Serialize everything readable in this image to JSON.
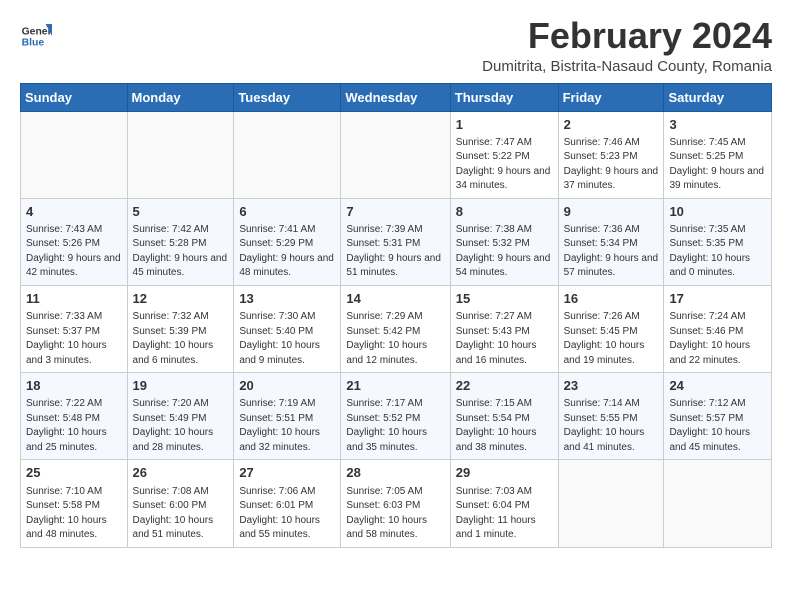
{
  "header": {
    "logo_general": "General",
    "logo_blue": "Blue",
    "month_title": "February 2024",
    "subtitle": "Dumitrita, Bistrita-Nasaud County, Romania"
  },
  "calendar": {
    "days_of_week": [
      "Sunday",
      "Monday",
      "Tuesday",
      "Wednesday",
      "Thursday",
      "Friday",
      "Saturday"
    ],
    "rows": [
      [
        {
          "day": "",
          "info": ""
        },
        {
          "day": "",
          "info": ""
        },
        {
          "day": "",
          "info": ""
        },
        {
          "day": "",
          "info": ""
        },
        {
          "day": "1",
          "info": "Sunrise: 7:47 AM\nSunset: 5:22 PM\nDaylight: 9 hours and 34 minutes."
        },
        {
          "day": "2",
          "info": "Sunrise: 7:46 AM\nSunset: 5:23 PM\nDaylight: 9 hours and 37 minutes."
        },
        {
          "day": "3",
          "info": "Sunrise: 7:45 AM\nSunset: 5:25 PM\nDaylight: 9 hours and 39 minutes."
        }
      ],
      [
        {
          "day": "4",
          "info": "Sunrise: 7:43 AM\nSunset: 5:26 PM\nDaylight: 9 hours and 42 minutes."
        },
        {
          "day": "5",
          "info": "Sunrise: 7:42 AM\nSunset: 5:28 PM\nDaylight: 9 hours and 45 minutes."
        },
        {
          "day": "6",
          "info": "Sunrise: 7:41 AM\nSunset: 5:29 PM\nDaylight: 9 hours and 48 minutes."
        },
        {
          "day": "7",
          "info": "Sunrise: 7:39 AM\nSunset: 5:31 PM\nDaylight: 9 hours and 51 minutes."
        },
        {
          "day": "8",
          "info": "Sunrise: 7:38 AM\nSunset: 5:32 PM\nDaylight: 9 hours and 54 minutes."
        },
        {
          "day": "9",
          "info": "Sunrise: 7:36 AM\nSunset: 5:34 PM\nDaylight: 9 hours and 57 minutes."
        },
        {
          "day": "10",
          "info": "Sunrise: 7:35 AM\nSunset: 5:35 PM\nDaylight: 10 hours and 0 minutes."
        }
      ],
      [
        {
          "day": "11",
          "info": "Sunrise: 7:33 AM\nSunset: 5:37 PM\nDaylight: 10 hours and 3 minutes."
        },
        {
          "day": "12",
          "info": "Sunrise: 7:32 AM\nSunset: 5:39 PM\nDaylight: 10 hours and 6 minutes."
        },
        {
          "day": "13",
          "info": "Sunrise: 7:30 AM\nSunset: 5:40 PM\nDaylight: 10 hours and 9 minutes."
        },
        {
          "day": "14",
          "info": "Sunrise: 7:29 AM\nSunset: 5:42 PM\nDaylight: 10 hours and 12 minutes."
        },
        {
          "day": "15",
          "info": "Sunrise: 7:27 AM\nSunset: 5:43 PM\nDaylight: 10 hours and 16 minutes."
        },
        {
          "day": "16",
          "info": "Sunrise: 7:26 AM\nSunset: 5:45 PM\nDaylight: 10 hours and 19 minutes."
        },
        {
          "day": "17",
          "info": "Sunrise: 7:24 AM\nSunset: 5:46 PM\nDaylight: 10 hours and 22 minutes."
        }
      ],
      [
        {
          "day": "18",
          "info": "Sunrise: 7:22 AM\nSunset: 5:48 PM\nDaylight: 10 hours and 25 minutes."
        },
        {
          "day": "19",
          "info": "Sunrise: 7:20 AM\nSunset: 5:49 PM\nDaylight: 10 hours and 28 minutes."
        },
        {
          "day": "20",
          "info": "Sunrise: 7:19 AM\nSunset: 5:51 PM\nDaylight: 10 hours and 32 minutes."
        },
        {
          "day": "21",
          "info": "Sunrise: 7:17 AM\nSunset: 5:52 PM\nDaylight: 10 hours and 35 minutes."
        },
        {
          "day": "22",
          "info": "Sunrise: 7:15 AM\nSunset: 5:54 PM\nDaylight: 10 hours and 38 minutes."
        },
        {
          "day": "23",
          "info": "Sunrise: 7:14 AM\nSunset: 5:55 PM\nDaylight: 10 hours and 41 minutes."
        },
        {
          "day": "24",
          "info": "Sunrise: 7:12 AM\nSunset: 5:57 PM\nDaylight: 10 hours and 45 minutes."
        }
      ],
      [
        {
          "day": "25",
          "info": "Sunrise: 7:10 AM\nSunset: 5:58 PM\nDaylight: 10 hours and 48 minutes."
        },
        {
          "day": "26",
          "info": "Sunrise: 7:08 AM\nSunset: 6:00 PM\nDaylight: 10 hours and 51 minutes."
        },
        {
          "day": "27",
          "info": "Sunrise: 7:06 AM\nSunset: 6:01 PM\nDaylight: 10 hours and 55 minutes."
        },
        {
          "day": "28",
          "info": "Sunrise: 7:05 AM\nSunset: 6:03 PM\nDaylight: 10 hours and 58 minutes."
        },
        {
          "day": "29",
          "info": "Sunrise: 7:03 AM\nSunset: 6:04 PM\nDaylight: 11 hours and 1 minute."
        },
        {
          "day": "",
          "info": ""
        },
        {
          "day": "",
          "info": ""
        }
      ]
    ]
  }
}
